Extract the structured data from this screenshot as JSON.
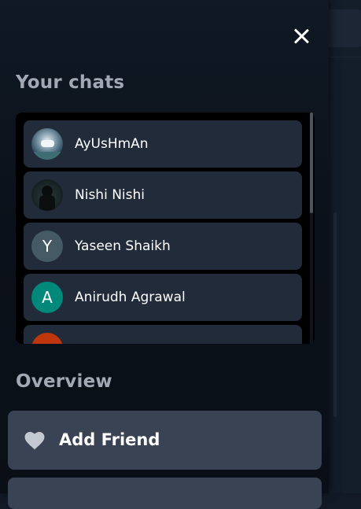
{
  "drawer": {
    "close_icon": "close-icon",
    "chats_title": "Your chats",
    "overview_title": "Overview"
  },
  "chats": [
    {
      "name": "AyUsHmAn",
      "avatar_type": "photo",
      "avatar_letter": ""
    },
    {
      "name": "Nishi Nishi",
      "avatar_type": "photo",
      "avatar_letter": ""
    },
    {
      "name": "Yaseen Shaikh",
      "avatar_type": "letter",
      "avatar_letter": "Y",
      "avatar_color": "#455a64"
    },
    {
      "name": "Anirudh Agrawal",
      "avatar_type": "letter",
      "avatar_letter": "A",
      "avatar_color": "#00897b"
    },
    {
      "name": "",
      "avatar_type": "letter",
      "avatar_letter": "",
      "avatar_color": "#bf360c"
    }
  ],
  "overview": {
    "add_friend_label": "Add Friend",
    "add_friend_icon": "heart-icon"
  },
  "colors": {
    "panel_bg": "#000000",
    "chat_item_bg": "#212b3a",
    "button_bg": "#394354",
    "section_title": "#a3a9b4"
  }
}
